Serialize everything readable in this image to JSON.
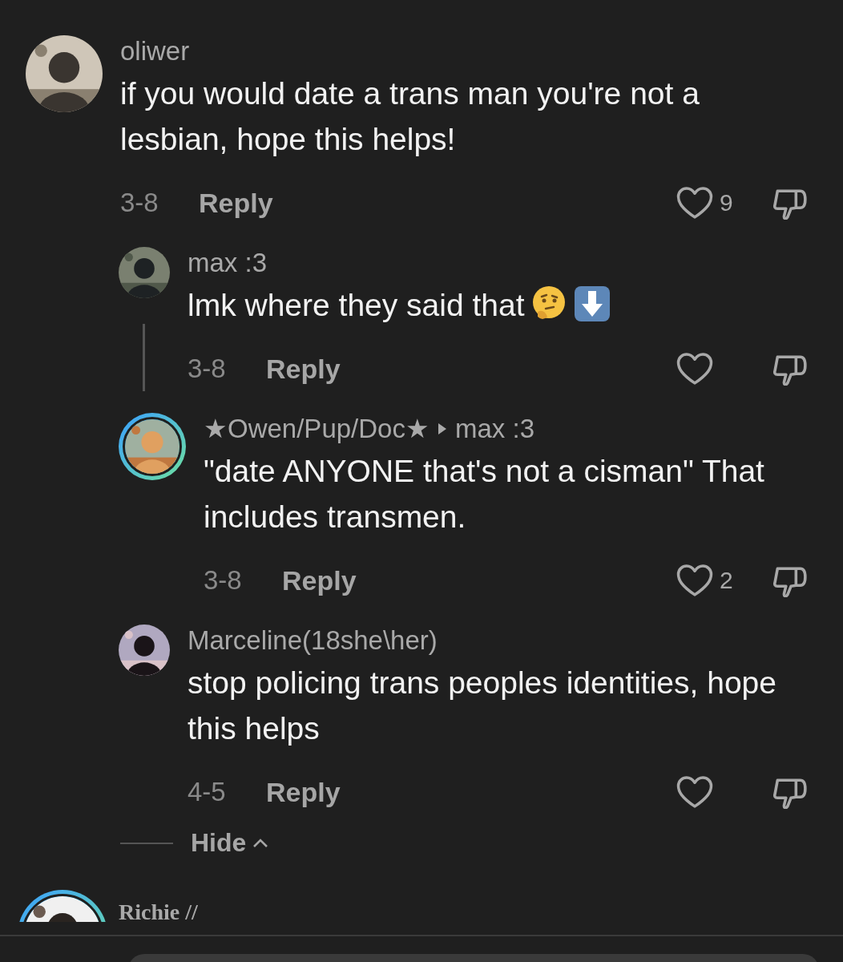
{
  "comments": [
    {
      "author": "oliwer",
      "text": "if you would date a trans man you're not a lesbian, hope this helps!",
      "date": "3-8",
      "reply_label": "Reply",
      "likes": "9",
      "avatar_ring": false,
      "replies": [
        {
          "author": "max :3",
          "text": "lmk where they said that",
          "emoji": [
            {
              "kind": "thinking"
            },
            {
              "kind": "down-arrow"
            }
          ],
          "date": "3-8",
          "reply_label": "Reply",
          "avatar_ring": false,
          "thread_line": true
        },
        {
          "author": "★Owen/Pup/Doc★",
          "reply_to": "max :3",
          "text": "\"date ANYONE that's not a cisman\" That includes transmen.",
          "date": "3-8",
          "reply_label": "Reply",
          "likes": "2",
          "avatar_ring": true,
          "thread_line": false
        },
        {
          "author": "Marceline(18she\\her)",
          "text": "stop policing trans peoples identities, hope this helps",
          "date": "4-5",
          "reply_label": "Reply",
          "avatar_ring": false,
          "thread_line": false
        }
      ],
      "collapse_label": "Hide"
    },
    {
      "author": "Richie //",
      "avatar_ring": true
    }
  ]
}
